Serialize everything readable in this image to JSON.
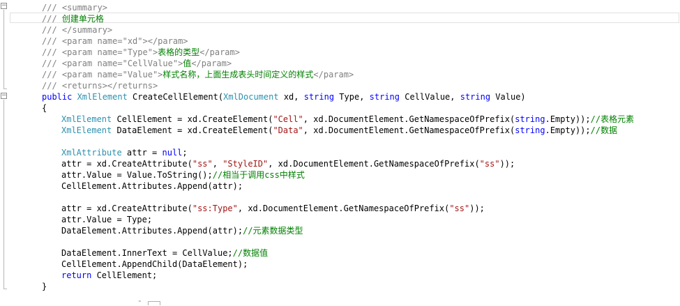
{
  "colors": {
    "background": "#ffffff",
    "doc_comment": "#808080",
    "comment": "#008000",
    "keyword": "#0000ff",
    "type": "#2b91af",
    "string": "#a31515",
    "plain": "#000000"
  },
  "gutter": {
    "collapse_symbol": "−"
  },
  "lines": [
    {
      "indent": 60,
      "tokens": [
        {
          "k": "doc",
          "t": "/// <summary>"
        }
      ]
    },
    {
      "indent": 60,
      "tokens": [
        {
          "k": "doc",
          "t": "/// "
        },
        {
          "k": "comment",
          "t": "创建单元格"
        }
      ]
    },
    {
      "indent": 60,
      "tokens": [
        {
          "k": "doc",
          "t": "/// </summary>"
        }
      ]
    },
    {
      "indent": 60,
      "tokens": [
        {
          "k": "doc",
          "t": "/// <param name=\"xd\"></param>"
        }
      ]
    },
    {
      "indent": 60,
      "tokens": [
        {
          "k": "doc",
          "t": "/// <param name=\"Type\">"
        },
        {
          "k": "comment",
          "t": "表格的类型"
        },
        {
          "k": "doc",
          "t": "</param>"
        }
      ]
    },
    {
      "indent": 60,
      "tokens": [
        {
          "k": "doc",
          "t": "/// <param name=\"CellValue\">"
        },
        {
          "k": "comment",
          "t": "值"
        },
        {
          "k": "doc",
          "t": "</param>"
        }
      ]
    },
    {
      "indent": 60,
      "tokens": [
        {
          "k": "doc",
          "t": "/// <param name=\"Value\">"
        },
        {
          "k": "comment",
          "t": "样式名称，上面生成表头时间定义的样式"
        },
        {
          "k": "doc",
          "t": "</param>"
        }
      ]
    },
    {
      "indent": 60,
      "tokens": [
        {
          "k": "doc",
          "t": "/// <returns></returns>"
        }
      ]
    },
    {
      "indent": 60,
      "tokens": [
        {
          "k": "kw",
          "t": "public "
        },
        {
          "k": "type",
          "t": "XmlElement"
        },
        {
          "k": "plain",
          "t": " CreateCellElement("
        },
        {
          "k": "type",
          "t": "XmlDocument"
        },
        {
          "k": "plain",
          "t": " xd, "
        },
        {
          "k": "kw",
          "t": "string"
        },
        {
          "k": "plain",
          "t": " Type, "
        },
        {
          "k": "kw",
          "t": "string"
        },
        {
          "k": "plain",
          "t": " CellValue, "
        },
        {
          "k": "kw",
          "t": "string"
        },
        {
          "k": "plain",
          "t": " Value)"
        }
      ]
    },
    {
      "indent": 60,
      "tokens": [
        {
          "k": "plain",
          "t": "{"
        }
      ]
    },
    {
      "indent": 88,
      "tokens": [
        {
          "k": "type",
          "t": "XmlElement"
        },
        {
          "k": "plain",
          "t": " CellElement = xd.CreateElement("
        },
        {
          "k": "str",
          "t": "\"Cell\""
        },
        {
          "k": "plain",
          "t": ", xd.DocumentElement.GetNamespaceOfPrefix("
        },
        {
          "k": "kw",
          "t": "string"
        },
        {
          "k": "plain",
          "t": ".Empty));"
        },
        {
          "k": "comment",
          "t": "//表格元素"
        }
      ]
    },
    {
      "indent": 88,
      "tokens": [
        {
          "k": "type",
          "t": "XmlElement"
        },
        {
          "k": "plain",
          "t": " DataElement = xd.CreateElement("
        },
        {
          "k": "str",
          "t": "\"Data\""
        },
        {
          "k": "plain",
          "t": ", xd.DocumentElement.GetNamespaceOfPrefix("
        },
        {
          "k": "kw",
          "t": "string"
        },
        {
          "k": "plain",
          "t": ".Empty));"
        },
        {
          "k": "comment",
          "t": "//数据"
        }
      ]
    },
    {
      "indent": 88,
      "tokens": []
    },
    {
      "indent": 88,
      "tokens": [
        {
          "k": "type",
          "t": "XmlAttribute"
        },
        {
          "k": "plain",
          "t": " attr = "
        },
        {
          "k": "kw",
          "t": "null"
        },
        {
          "k": "plain",
          "t": ";"
        }
      ]
    },
    {
      "indent": 88,
      "tokens": [
        {
          "k": "plain",
          "t": "attr = xd.CreateAttribute("
        },
        {
          "k": "str",
          "t": "\"ss\""
        },
        {
          "k": "plain",
          "t": ", "
        },
        {
          "k": "str",
          "t": "\"StyleID\""
        },
        {
          "k": "plain",
          "t": ", xd.DocumentElement.GetNamespaceOfPrefix("
        },
        {
          "k": "str",
          "t": "\"ss\""
        },
        {
          "k": "plain",
          "t": "));"
        }
      ]
    },
    {
      "indent": 88,
      "tokens": [
        {
          "k": "plain",
          "t": "attr.Value = Value.ToString();"
        },
        {
          "k": "comment",
          "t": "//相当于调用css中样式"
        }
      ]
    },
    {
      "indent": 88,
      "tokens": [
        {
          "k": "plain",
          "t": "CellElement.Attributes.Append(attr);"
        }
      ]
    },
    {
      "indent": 88,
      "tokens": []
    },
    {
      "indent": 88,
      "tokens": [
        {
          "k": "plain",
          "t": "attr = xd.CreateAttribute("
        },
        {
          "k": "str",
          "t": "\"ss:Type\""
        },
        {
          "k": "plain",
          "t": ", xd.DocumentElement.GetNamespaceOfPrefix("
        },
        {
          "k": "str",
          "t": "\"ss\""
        },
        {
          "k": "plain",
          "t": "));"
        }
      ]
    },
    {
      "indent": 88,
      "tokens": [
        {
          "k": "plain",
          "t": "attr.Value = Type;"
        }
      ]
    },
    {
      "indent": 88,
      "tokens": [
        {
          "k": "plain",
          "t": "DataElement.Attributes.Append(attr);"
        },
        {
          "k": "comment",
          "t": "//元素数据类型"
        }
      ]
    },
    {
      "indent": 88,
      "tokens": []
    },
    {
      "indent": 88,
      "tokens": [
        {
          "k": "plain",
          "t": "DataElement.InnerText = CellValue;"
        },
        {
          "k": "comment",
          "t": "//数据值"
        }
      ]
    },
    {
      "indent": 88,
      "tokens": [
        {
          "k": "plain",
          "t": "CellElement.AppendChild(DataElement);"
        }
      ]
    },
    {
      "indent": 88,
      "tokens": [
        {
          "k": "kw",
          "t": "return"
        },
        {
          "k": "plain",
          "t": " CellElement;"
        }
      ]
    },
    {
      "indent": 60,
      "tokens": [
        {
          "k": "plain",
          "t": "}"
        }
      ]
    }
  ],
  "bottom_fragment": "\""
}
